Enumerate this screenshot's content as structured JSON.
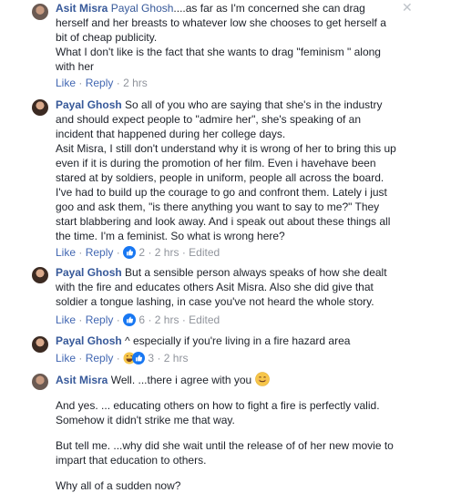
{
  "comments": [
    {
      "name": "Asit Misra",
      "mention": "Payal Ghosh",
      "lines": [
        "....as far as I'm concerned she can drag",
        "herself and her breasts to whatever low she chooses to get herself a",
        "bit of cheap publicity.",
        "What I don't like is the fact that she wants to drag \"feminism \" along",
        "with her"
      ],
      "like": "Like",
      "reply": "Reply",
      "time": "2 hrs"
    },
    {
      "name": "Payal Ghosh",
      "lines": [
        "So all of you who are saying that she's in the industry",
        "and should expect people to \"admire her\", she's speaking of an",
        "incident that happened during her college days.",
        "Asit Misra, I still don't understand why it is wrong of her to bring this up",
        "even if it is during the promotion of her film. Even i havehave been",
        "stared at by soldiers, people in uniform, people all across the board.",
        "I've had to build up the courage to go and confront them. Lately i just",
        "goo and ask them, \"is there anything you want to say to me?\" They",
        "start blabbering and look away. And i speak out about these things all",
        "the time. I'm a feminist. So what is wrong here?"
      ],
      "like": "Like",
      "reply": "Reply",
      "reactions": "2",
      "time": "2 hrs",
      "edited": "Edited"
    },
    {
      "name": "Payal Ghosh",
      "lines": [
        "But a sensible person always speaks of how she dealt",
        "with the fire and educates others Asit Misra. Also she did give that",
        "soldier a tongue lashing, in case you've not heard the whole story."
      ],
      "like": "Like",
      "reply": "Reply",
      "reactions": "6",
      "time": "2 hrs",
      "edited": "Edited"
    },
    {
      "name": "Payal Ghosh",
      "lines": [
        "^ especially if you're living in a fire hazard area"
      ],
      "like": "Like",
      "reply": "Reply",
      "reactions": "3",
      "time": "2 hrs"
    },
    {
      "name": "Asit Misra",
      "first": "Well. ...there i agree with you",
      "paras": [
        "And yes. ... educating others on how to fight a fire is perfectly valid.",
        "Somehow it didn't strike me that way.",
        "But tell me. ...why did she wait until the release of of her new movie to",
        "impart that education to others.",
        "Why all of a sudden now?"
      ]
    }
  ],
  "close_glyph": "✕",
  "separator": "·",
  "colors": {
    "link": "#365899",
    "action": "#4267b2",
    "meta": "#90949c",
    "like_blue": "#1877f2",
    "haha_yellow": "#f7c64a"
  }
}
